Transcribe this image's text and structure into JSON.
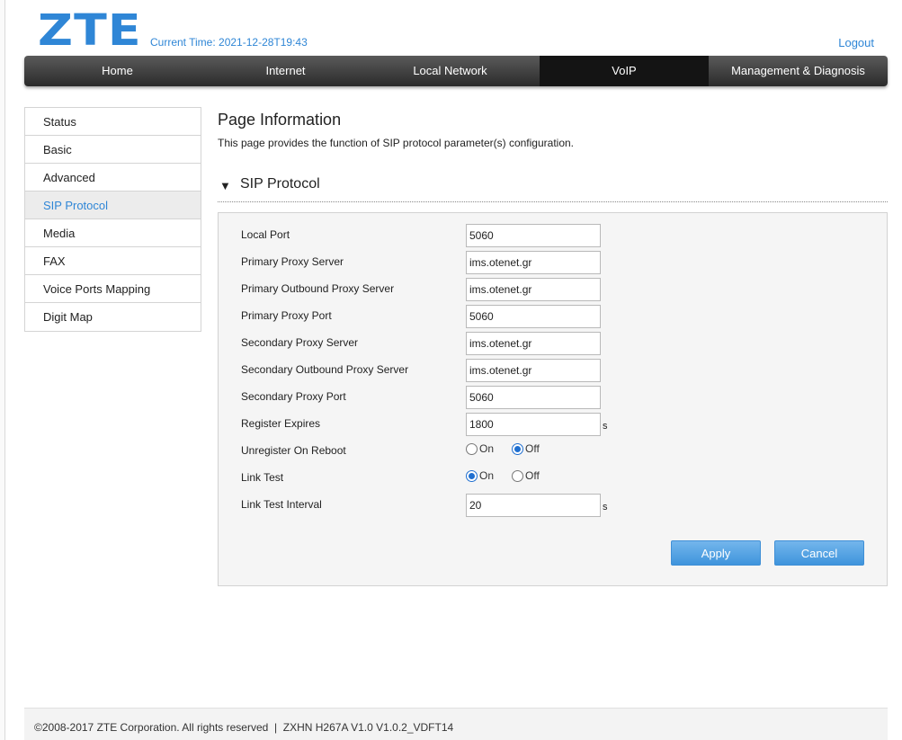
{
  "header": {
    "logo": "ZTE",
    "current_time_label": "Current Time:",
    "current_time": "2021-12-28T19:43",
    "logout": "Logout"
  },
  "nav": {
    "tabs": [
      {
        "label": "Home"
      },
      {
        "label": "Internet"
      },
      {
        "label": "Local Network"
      },
      {
        "label": "VoIP",
        "active": true
      },
      {
        "label": "Management & Diagnosis"
      }
    ]
  },
  "sidebar": {
    "items": [
      {
        "label": "Status"
      },
      {
        "label": "Basic"
      },
      {
        "label": "Advanced"
      },
      {
        "label": "SIP Protocol",
        "active": true
      },
      {
        "label": "Media"
      },
      {
        "label": "FAX"
      },
      {
        "label": "Voice Ports Mapping"
      },
      {
        "label": "Digit Map"
      }
    ]
  },
  "page": {
    "title": "Page Information",
    "description": "This page provides the function of SIP protocol parameter(s) configuration."
  },
  "section": {
    "title": "SIP Protocol"
  },
  "form": {
    "local_port": {
      "label": "Local Port",
      "value": "5060"
    },
    "primary_proxy_server": {
      "label": "Primary Proxy Server",
      "value": "ims.otenet.gr"
    },
    "primary_outbound_proxy_server": {
      "label": "Primary Outbound Proxy Server",
      "value": "ims.otenet.gr"
    },
    "primary_proxy_port": {
      "label": "Primary Proxy Port",
      "value": "5060"
    },
    "secondary_proxy_server": {
      "label": "Secondary Proxy Server",
      "value": "ims.otenet.gr"
    },
    "secondary_outbound_proxy_server": {
      "label": "Secondary Outbound Proxy Server",
      "value": "ims.otenet.gr"
    },
    "secondary_proxy_port": {
      "label": "Secondary Proxy Port",
      "value": "5060"
    },
    "register_expires": {
      "label": "Register Expires",
      "value": "1800",
      "unit": "s"
    },
    "unregister_on_reboot": {
      "label": "Unregister On Reboot",
      "on": "On",
      "off": "Off",
      "selected": "off"
    },
    "link_test": {
      "label": "Link Test",
      "on": "On",
      "off": "Off",
      "selected": "on"
    },
    "link_test_interval": {
      "label": "Link Test Interval",
      "value": "20",
      "unit": "s"
    }
  },
  "buttons": {
    "apply": "Apply",
    "cancel": "Cancel"
  },
  "footer": {
    "copyright": "©2008-2017 ZTE Corporation. All rights reserved",
    "separator": "  |  ",
    "version": "ZXHN H267A V1.0 V1.0.2_VDFT14"
  },
  "colors": {
    "accent": "#2f86d6",
    "nav_bg": "#3a3a3a",
    "nav_active": "#141414",
    "button": "#4a9de0",
    "radio": "#1f6fd0"
  }
}
